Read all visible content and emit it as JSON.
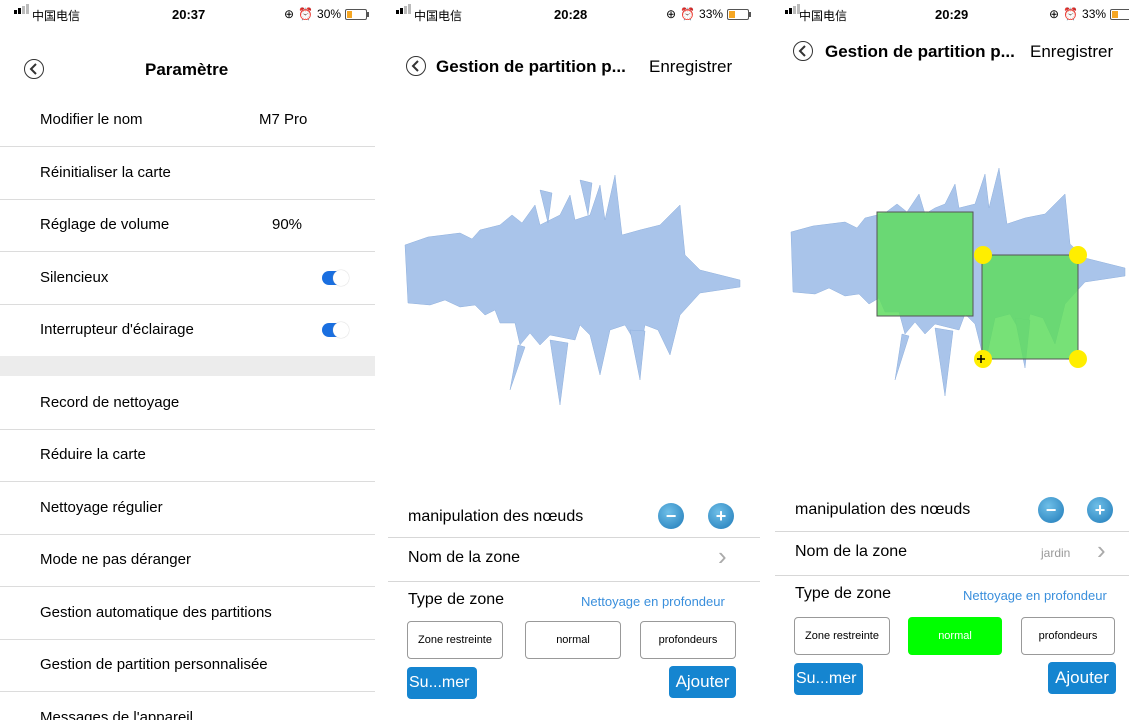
{
  "panel1": {
    "status": {
      "carrier": "中国电信",
      "time": "20:37",
      "battery": "30%",
      "battery_level": 0.3
    },
    "title": "Paramètre",
    "rows": [
      {
        "label": "Modifier le nom",
        "value": "M7 Pro"
      },
      {
        "label": "Réinitialiser la carte"
      },
      {
        "label": "Réglage de volume",
        "value": "90%"
      },
      {
        "label": "Silencieux",
        "toggle": true
      },
      {
        "label": "Interrupteur d'éclairage",
        "toggle": true
      }
    ],
    "rows2": [
      {
        "label": "Record de nettoyage"
      },
      {
        "label": "Réduire la carte"
      },
      {
        "label": "Nettoyage régulier"
      },
      {
        "label": "Mode ne pas déranger"
      },
      {
        "label": "Gestion automatique des partitions"
      },
      {
        "label": "Gestion de partition personnalisée"
      },
      {
        "label": "Messages de l'appareil"
      }
    ]
  },
  "panel2": {
    "status": {
      "carrier": "中国电信",
      "time": "20:28",
      "battery": "33%",
      "battery_level": 0.33
    },
    "title": "Gestion de partition p...",
    "save": "Enregistrer",
    "nodes_label": "manipulation des nœuds",
    "zone_name_label": "Nom de la zone",
    "zone_type_label": "Type de zone",
    "zone_type_value": "Nettoyage en profondeur",
    "types": [
      "Zone restreinte",
      "normal",
      "profondeurs"
    ],
    "delete": "Su...mer",
    "add": "Ajouter"
  },
  "panel3": {
    "status": {
      "carrier": "中国电信",
      "time": "20:29",
      "battery": "33%",
      "battery_level": 0.33
    },
    "title": "Gestion de partition p...",
    "save": "Enregistrer",
    "nodes_label": "manipulation des nœuds",
    "zone_name_label": "Nom de la zone",
    "zone_name_value": "jardin",
    "zone_type_label": "Type de zone",
    "zone_type_value": "Nettoyage en profondeur",
    "types": [
      "Zone restreinte",
      "normal",
      "profondeurs"
    ],
    "active_type": "normal",
    "delete": "Su...mer",
    "add": "Ajouter"
  },
  "colors": {
    "accent": "#1585d0",
    "toggle": "#1a6fe0",
    "map": "#a9c4ea",
    "zone": "#6ee36e",
    "handle": "#ffee00",
    "link": "#3a8fdc"
  }
}
